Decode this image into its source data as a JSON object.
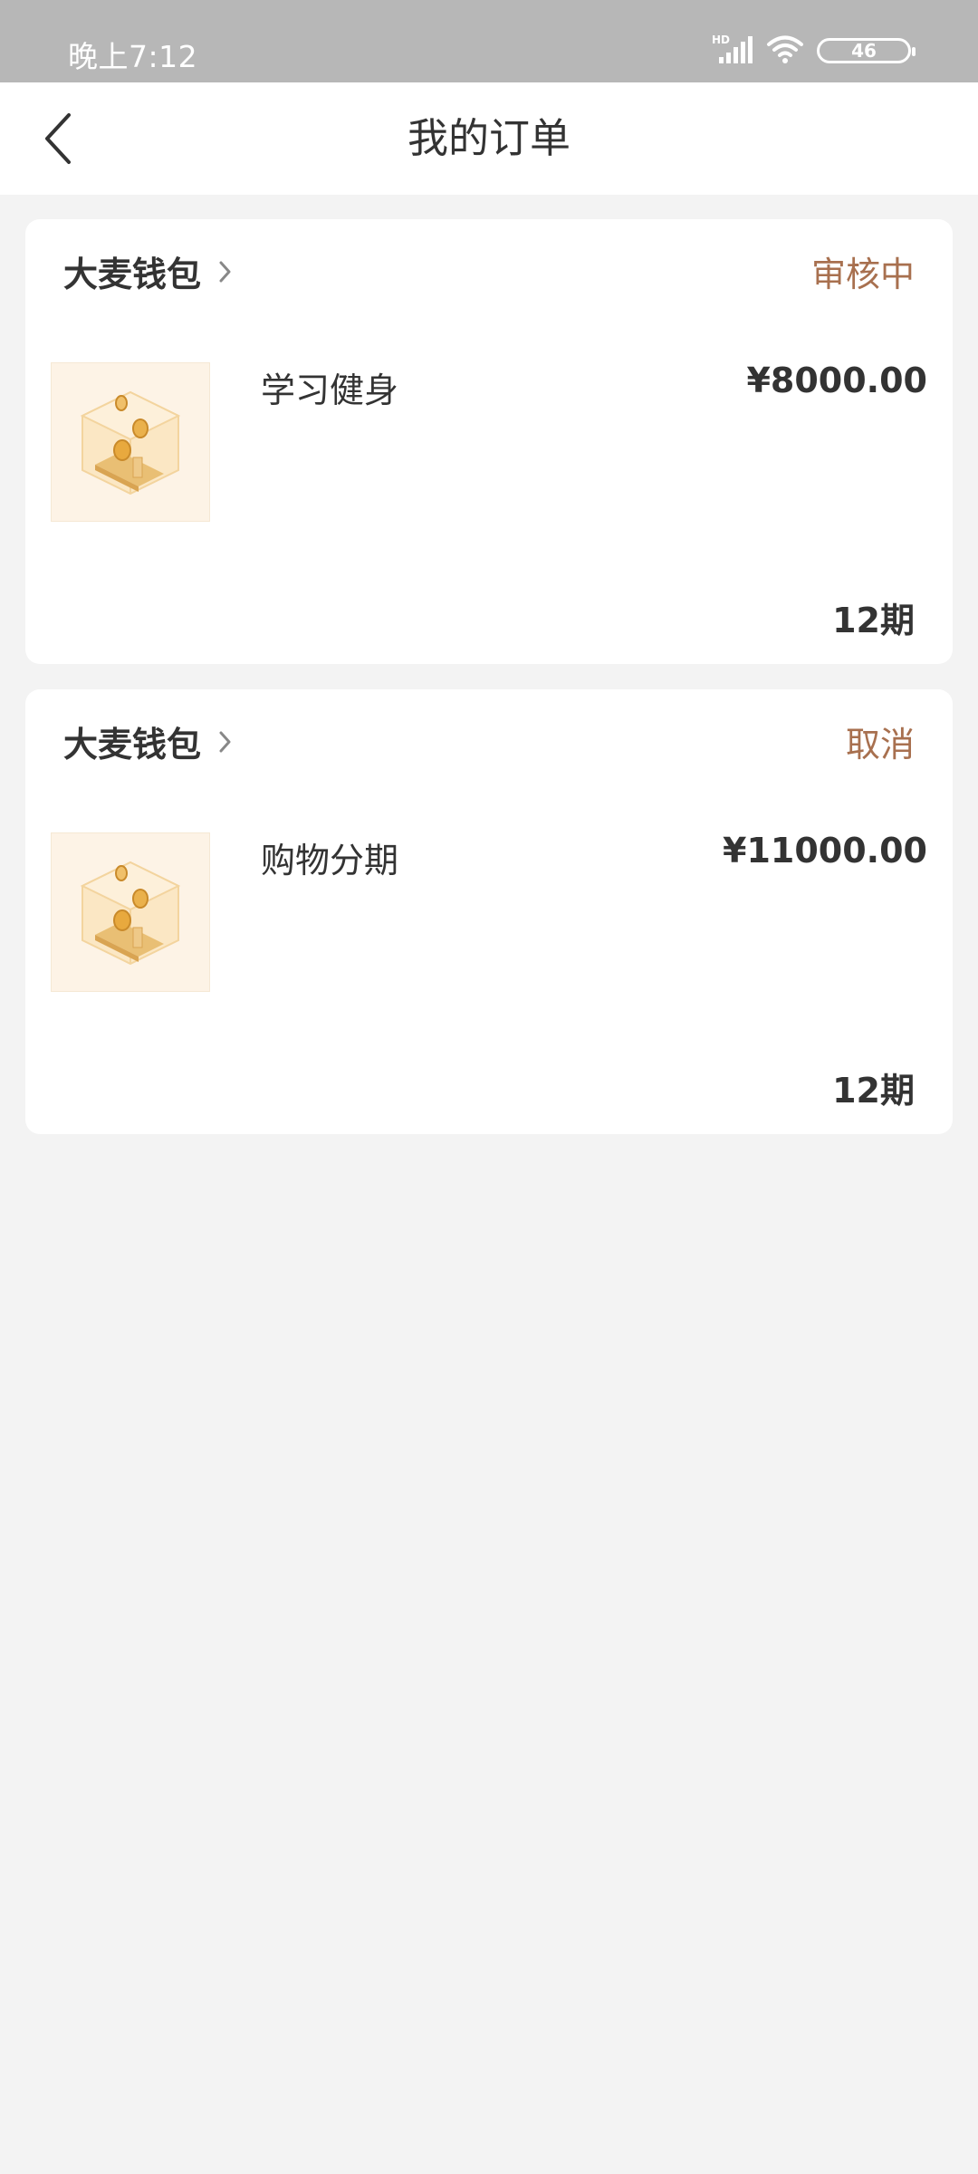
{
  "status_bar": {
    "time": "晚上7:12",
    "battery": "46",
    "signal_label": "HD",
    "icons": [
      "signal-icon",
      "wifi-icon",
      "battery-icon"
    ]
  },
  "nav": {
    "title": "我的订单",
    "back_icon": "chevron-left-icon"
  },
  "colors": {
    "status_text": "#a8704f",
    "background": "#f3f3f3",
    "card": "#ffffff"
  },
  "orders": [
    {
      "shop": "大麦钱包",
      "status": "审核中",
      "product": "学习健身",
      "price": "¥8000.00",
      "period": "12期"
    },
    {
      "shop": "大麦钱包",
      "status": "取消",
      "product": "购物分期",
      "price": "¥11000.00",
      "period": "12期"
    }
  ]
}
